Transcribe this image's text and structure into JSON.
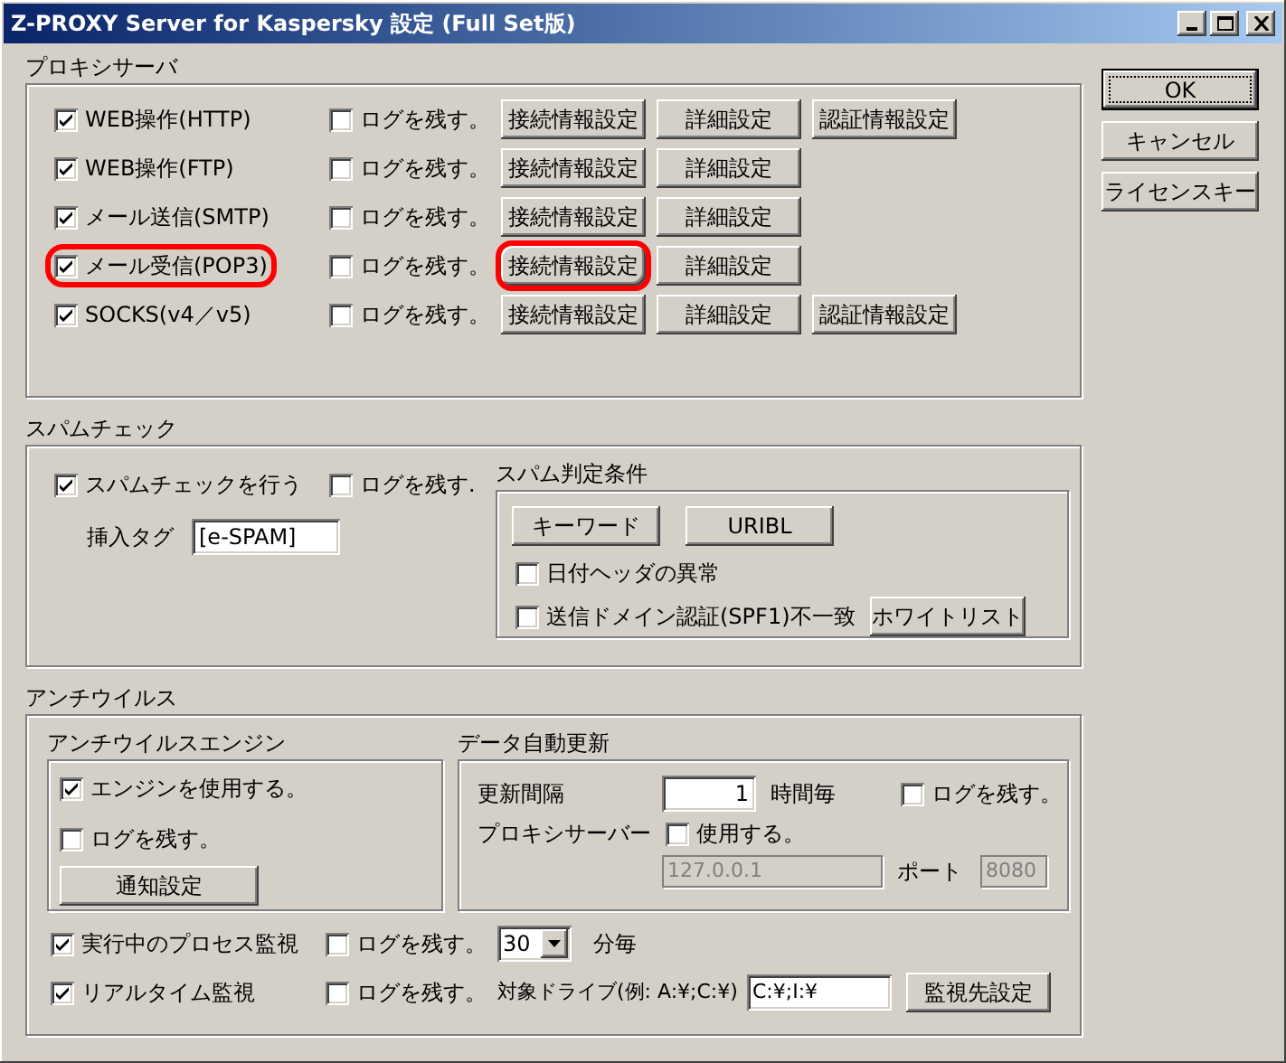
{
  "window": {
    "title": "Z-PROXY Server for Kaspersky 設定 (Full Set版)"
  },
  "proxy": {
    "title": "プロキシサーバ",
    "rows": [
      {
        "label": "WEB操作(HTTP)",
        "checked": true,
        "highlighted": false,
        "log": {
          "label": "ログを残す。",
          "checked": false
        },
        "buttons": [
          {
            "label": "接続情報設定",
            "highlighted": false
          },
          {
            "label": "詳細設定",
            "highlighted": false
          },
          {
            "label": "認証情報設定",
            "highlighted": false
          }
        ]
      },
      {
        "label": "WEB操作(FTP)",
        "checked": true,
        "highlighted": false,
        "log": {
          "label": "ログを残す。",
          "checked": false
        },
        "buttons": [
          {
            "label": "接続情報設定",
            "highlighted": false
          },
          {
            "label": "詳細設定",
            "highlighted": false
          }
        ]
      },
      {
        "label": "メール送信(SMTP)",
        "checked": true,
        "highlighted": false,
        "log": {
          "label": "ログを残す。",
          "checked": false
        },
        "buttons": [
          {
            "label": "接続情報設定",
            "highlighted": false
          },
          {
            "label": "詳細設定",
            "highlighted": false
          }
        ]
      },
      {
        "label": "メール受信(POP3)",
        "checked": true,
        "highlighted": true,
        "log": {
          "label": "ログを残す。",
          "checked": false
        },
        "buttons": [
          {
            "label": "接続情報設定",
            "highlighted": true
          },
          {
            "label": "詳細設定",
            "highlighted": false
          }
        ]
      },
      {
        "label": "SOCKS(v4／v5)",
        "checked": true,
        "highlighted": false,
        "log": {
          "label": "ログを残す。",
          "checked": false
        },
        "buttons": [
          {
            "label": "接続情報設定",
            "highlighted": false
          },
          {
            "label": "詳細設定",
            "highlighted": false
          },
          {
            "label": "認証情報設定",
            "highlighted": false
          }
        ]
      }
    ]
  },
  "spam": {
    "title": "スパムチェック",
    "enable": {
      "label": "スパムチェックを行う",
      "checked": true
    },
    "log": {
      "label": "ログを残す.",
      "checked": false
    },
    "tag_label": "挿入タグ",
    "tag_value": "[e-SPAM]",
    "conditions": {
      "title": "スパム判定条件",
      "buttons": [
        "キーワード",
        "URIBL"
      ],
      "date_header": {
        "label": "日付ヘッダの異常",
        "checked": false
      },
      "spf": {
        "label": "送信ドメイン認証(SPF1)不一致",
        "checked": false
      },
      "whitelist_button": "ホワイトリスト"
    }
  },
  "antivirus": {
    "title": "アンチウイルス",
    "engine": {
      "title": "アンチウイルスエンジン",
      "use": {
        "label": "エンジンを使用する。",
        "checked": true
      },
      "log": {
        "label": "ログを残す。",
        "checked": false
      },
      "notify_button": "通知設定"
    },
    "update": {
      "title": "データ自動更新",
      "interval_label": "更新間隔",
      "interval_value": "1",
      "interval_unit": "時間毎",
      "log": {
        "label": "ログを残す。",
        "checked": false
      },
      "proxy_label": "プロキシサーバー",
      "proxy_use": {
        "label": "使用する。",
        "checked": false
      },
      "proxy_host": "127.0.0.1",
      "port_label": "ポート",
      "port_value": "8080"
    },
    "process": {
      "label": "実行中のプロセス監視",
      "checked": true,
      "log": {
        "label": "ログを残す。",
        "checked": false
      },
      "minutes": "30",
      "unit": "分毎"
    },
    "realtime": {
      "label": "リアルタイム監視",
      "checked": true,
      "log": {
        "label": "ログを残す。",
        "checked": false
      },
      "drive_label": "対象ドライブ(例: A:¥;C:¥)",
      "drive_value": "C:¥;I:¥",
      "target_button": "監視先設定"
    }
  },
  "side_buttons": [
    {
      "label": "OK",
      "kind": "default"
    },
    {
      "label": "キャンセル",
      "kind": "normal"
    },
    {
      "label": "ライセンスキー",
      "kind": "normal"
    }
  ]
}
